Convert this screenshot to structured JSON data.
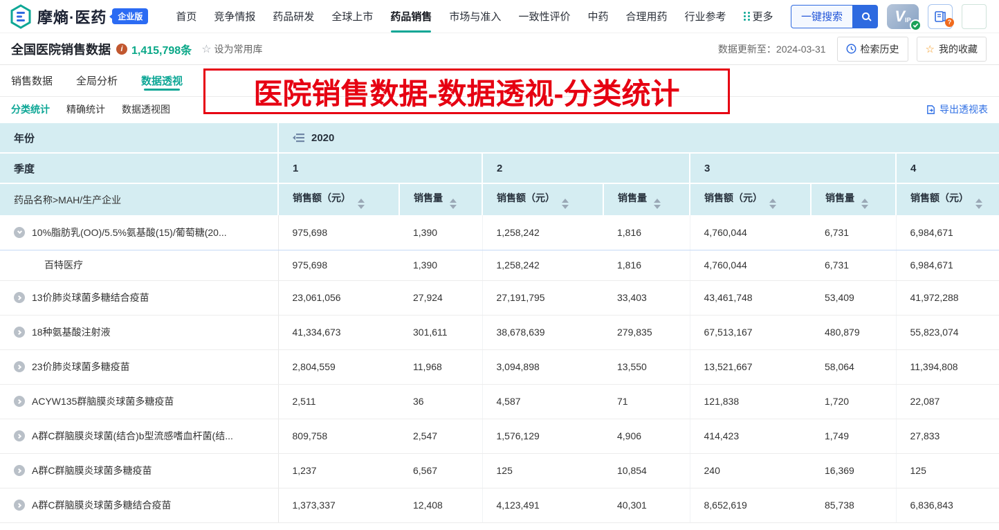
{
  "brand": {
    "logo_text": "摩熵·医药",
    "badge": "企业版"
  },
  "nav": {
    "items": [
      "首页",
      "竞争情报",
      "药品研发",
      "全球上市",
      "药品销售",
      "市场与准入",
      "一致性评价",
      "中药",
      "合理用药",
      "行业参考",
      "更多"
    ],
    "active": "药品销售",
    "search_label": "一键搜索",
    "vip_label_v": "V",
    "vip_label_ip": "IP"
  },
  "infobar": {
    "title": "全国医院销售数据",
    "count": "1,415,798条",
    "set_favorite": "设为常用库",
    "updated": "数据更新至：2024-03-31",
    "history_button": "检索历史",
    "collection_button": "我的收藏"
  },
  "tabs": {
    "items": [
      "销售数据",
      "全局分析",
      "数据透视"
    ],
    "active": "数据透视"
  },
  "subtabs": {
    "items": [
      "分类统计",
      "精确统计",
      "数据透视图"
    ],
    "active": "分类统计",
    "export_label": "导出透视表"
  },
  "annotation": {
    "text": "医院销售数据-数据透视-分类统计"
  },
  "pivot_table": {
    "year_label": "年份",
    "year_value": "2020",
    "quarter_label": "季度",
    "quarters": [
      "1",
      "2",
      "3",
      "4"
    ],
    "row_dim_label": "药品名称>MAH/生产企业",
    "amount_label": "销售额（元）",
    "qty_label": "销售量",
    "rows": [
      {
        "name": "10%脂肪乳(OO)/5.5%氨基酸(15)/葡萄糖(20...",
        "expand": "down",
        "child": false,
        "values": [
          "975,698",
          "1,390",
          "1,258,242",
          "1,816",
          "4,760,044",
          "6,731",
          "6,984,671"
        ]
      },
      {
        "name": "百特医疗",
        "expand": null,
        "child": true,
        "values": [
          "975,698",
          "1,390",
          "1,258,242",
          "1,816",
          "4,760,044",
          "6,731",
          "6,984,671"
        ]
      },
      {
        "name": "13价肺炎球菌多糖结合疫苗",
        "expand": "right",
        "child": false,
        "values": [
          "23,061,056",
          "27,924",
          "27,191,795",
          "33,403",
          "43,461,748",
          "53,409",
          "41,972,288"
        ]
      },
      {
        "name": "18种氨基酸注射液",
        "expand": "right",
        "child": false,
        "values": [
          "41,334,673",
          "301,611",
          "38,678,639",
          "279,835",
          "67,513,167",
          "480,879",
          "55,823,074"
        ]
      },
      {
        "name": "23价肺炎球菌多糖疫苗",
        "expand": "right",
        "child": false,
        "values": [
          "2,804,559",
          "11,968",
          "3,094,898",
          "13,550",
          "13,521,667",
          "58,064",
          "11,394,808"
        ]
      },
      {
        "name": "ACYW135群脑膜炎球菌多糖疫苗",
        "expand": "right",
        "child": false,
        "values": [
          "2,511",
          "36",
          "4,587",
          "71",
          "121,838",
          "1,720",
          "22,087"
        ]
      },
      {
        "name": "A群C群脑膜炎球菌(结合)b型流感嗜血杆菌(结...",
        "expand": "right",
        "child": false,
        "values": [
          "809,758",
          "2,547",
          "1,576,129",
          "4,906",
          "414,423",
          "1,749",
          "27,833"
        ]
      },
      {
        "name": "A群C群脑膜炎球菌多糖疫苗",
        "expand": "right",
        "child": false,
        "values": [
          "1,237",
          "6,567",
          "125",
          "10,854",
          "240",
          "16,369",
          "125"
        ]
      },
      {
        "name": "A群C群脑膜炎球菌多糖结合疫苗",
        "expand": "right",
        "child": false,
        "values": [
          "1,373,337",
          "12,408",
          "4,123,491",
          "40,301",
          "8,652,619",
          "85,738",
          "6,836,843"
        ]
      }
    ]
  },
  "colors": {
    "accent_teal": "#0ea796",
    "accent_blue": "#2e6ae0",
    "annotation_red": "#e60012",
    "header_bg": "#d5edf2",
    "star_orange": "#f59a23",
    "count_teal": "#0ba888"
  }
}
